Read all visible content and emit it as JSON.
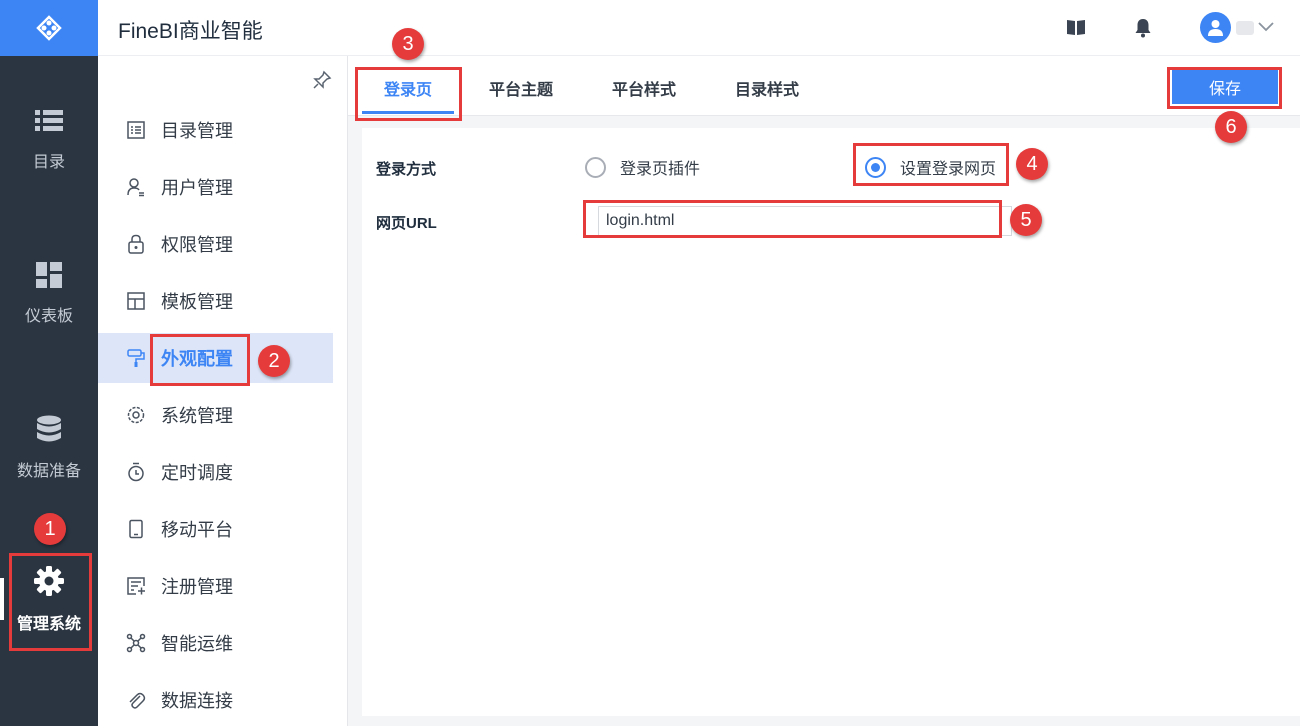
{
  "app": {
    "title": "FineBI商业智能"
  },
  "left_nav": {
    "items": [
      {
        "label": "目录",
        "icon": "list-icon"
      },
      {
        "label": "仪表板",
        "icon": "dashboard-icon"
      },
      {
        "label": "数据准备",
        "icon": "database-icon"
      },
      {
        "label": "管理系统",
        "icon": "gear-icon",
        "active": true
      }
    ]
  },
  "header": {
    "icons": [
      "book-icon",
      "bell-icon",
      "avatar",
      "chevron-down-icon"
    ]
  },
  "submenu": {
    "items": [
      {
        "label": "目录管理",
        "icon": "catalog-icon"
      },
      {
        "label": "用户管理",
        "icon": "user-icon"
      },
      {
        "label": "权限管理",
        "icon": "lock-icon"
      },
      {
        "label": "模板管理",
        "icon": "template-icon"
      },
      {
        "label": "外观配置",
        "icon": "paint-roller-icon",
        "active": true
      },
      {
        "label": "系统管理",
        "icon": "settings-icon"
      },
      {
        "label": "定时调度",
        "icon": "timer-icon"
      },
      {
        "label": "移动平台",
        "icon": "mobile-icon"
      },
      {
        "label": "注册管理",
        "icon": "register-icon"
      },
      {
        "label": "智能运维",
        "icon": "network-icon"
      },
      {
        "label": "数据连接",
        "icon": "paperclip-icon"
      }
    ]
  },
  "tabs": [
    {
      "label": "登录页",
      "active": true
    },
    {
      "label": "平台主题"
    },
    {
      "label": "平台样式"
    },
    {
      "label": "目录样式"
    }
  ],
  "save_label": "保存",
  "form": {
    "login_method_label": "登录方式",
    "options": [
      {
        "label": "登录页插件",
        "checked": false
      },
      {
        "label": "设置登录网页",
        "checked": true
      }
    ],
    "url_label": "网页URL",
    "url_value": "login.html"
  },
  "annotations": [
    "1",
    "2",
    "3",
    "4",
    "5",
    "6"
  ],
  "colors": {
    "accent": "#3d85f5",
    "nav_bg": "#2b3541",
    "highlight": "#e53b3b"
  }
}
